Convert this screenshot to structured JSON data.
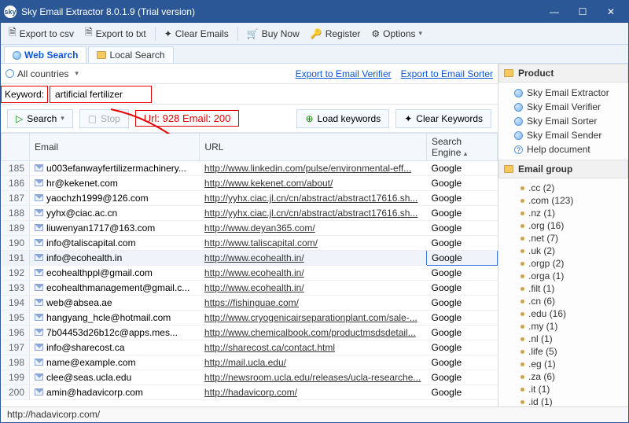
{
  "window_title": "Sky Email Extractor 8.0.1.9 (Trial version)",
  "toolbar": {
    "export_csv": "Export to csv",
    "export_txt": "Export to txt",
    "clear_emails": "Clear Emails",
    "buy_now": "Buy Now",
    "register": "Register",
    "options": "Options"
  },
  "tabs": {
    "web_search": "Web Search",
    "local_search": "Local Search"
  },
  "filter": {
    "all_countries": "All countries",
    "export_verifier": "Export to Email Verifier",
    "export_sorter": "Export to Email Sorter"
  },
  "keyword_label": "Keyword:",
  "keyword_value": "artificial fertilizer",
  "buttons": {
    "search": "Search",
    "stop": "Stop",
    "load_keywords": "Load keywords",
    "clear_keywords": "Clear Keywords"
  },
  "counter": "Url: 928 Email: 200",
  "columns": {
    "email": "Email",
    "url": "URL",
    "engine": "Search Engine"
  },
  "rows": [
    {
      "n": 185,
      "email": "u003efanwayfertilizermachinery...",
      "url": "http://www.linkedin.com/pulse/environmental-eff...",
      "se": "Google"
    },
    {
      "n": 186,
      "email": "hr@kekenet.com",
      "url": "http://www.kekenet.com/about/",
      "se": "Google"
    },
    {
      "n": 187,
      "email": "yaochzh1999@126.com",
      "url": "http://yyhx.ciac.jl.cn/cn/abstract/abstract17616.sh...",
      "se": "Google"
    },
    {
      "n": 188,
      "email": "yyhx@ciac.ac.cn",
      "url": "http://yyhx.ciac.jl.cn/cn/abstract/abstract17616.sh...",
      "se": "Google"
    },
    {
      "n": 189,
      "email": "liuwenyan1717@163.com",
      "url": "http://www.deyan365.com/",
      "se": "Google"
    },
    {
      "n": 190,
      "email": "info@taliscapital.com",
      "url": "http://www.taliscapital.com/",
      "se": "Google"
    },
    {
      "n": 191,
      "email": "info@ecohealth.in",
      "url": "http://www.ecohealth.in/",
      "se": "Google",
      "selected": true
    },
    {
      "n": 192,
      "email": "ecohealthppl@gmail.com",
      "url": "http://www.ecohealth.in/",
      "se": "Google"
    },
    {
      "n": 193,
      "email": "ecohealthmanagement@gmail.c...",
      "url": "http://www.ecohealth.in/",
      "se": "Google"
    },
    {
      "n": 194,
      "email": "web@absea.ae",
      "url": "https://fishinguae.com/",
      "se": "Google"
    },
    {
      "n": 195,
      "email": "hangyang_hcle@hotmail.com",
      "url": "http://www.cryogenicairseparationplant.com/sale-...",
      "se": "Google"
    },
    {
      "n": 196,
      "email": "7b04453d26b12c@apps.mes...",
      "url": "http://www.chemicalbook.com/productmsdsdetail...",
      "se": "Google"
    },
    {
      "n": 197,
      "email": "info@sharecost.ca",
      "url": "http://sharecost.ca/contact.html",
      "se": "Google"
    },
    {
      "n": 198,
      "email": "name@example.com",
      "url": "http://mail.ucla.edu/",
      "se": "Google"
    },
    {
      "n": 199,
      "email": "clee@seas.ucla.edu",
      "url": "http://newsroom.ucla.edu/releases/ucla-researche...",
      "se": "Google"
    },
    {
      "n": 200,
      "email": "amin@hadavicorp.com",
      "url": "http://hadavicorp.com/",
      "se": "Google"
    }
  ],
  "product_panel": {
    "title": "Product",
    "items": [
      "Sky Email Extractor",
      "Sky Email Verifier",
      "Sky Email Sorter",
      "Sky Email Sender"
    ],
    "help": "Help document"
  },
  "email_group_panel": {
    "title": "Email group",
    "items": [
      ".cc (2)",
      ".com (123)",
      ".nz (1)",
      ".org (16)",
      ".net (7)",
      ".uk (2)",
      ".orgp (2)",
      ".orga (1)",
      ".filt (1)",
      ".cn (6)",
      ".edu (16)",
      ".my (1)",
      ".nl (1)",
      ".life (5)",
      ".eg (1)",
      ".za (6)",
      ".it (1)",
      ".id (1)"
    ]
  },
  "status": "http://hadavicorp.com/"
}
